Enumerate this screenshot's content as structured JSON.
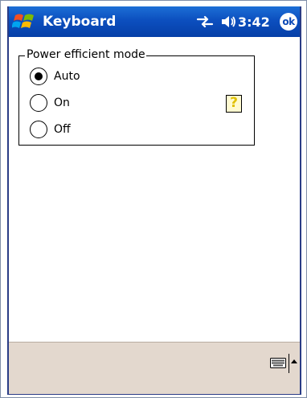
{
  "titlebar": {
    "title": "Keyboard",
    "clock": "3:42",
    "ok_label": "ok",
    "start_icon": "windows-flag-icon",
    "sync_icon": "connectivity-icon",
    "volume_icon": "speaker-icon"
  },
  "power_mode": {
    "group_label": "Power efficient mode",
    "options": [
      {
        "label": "Auto",
        "selected": true
      },
      {
        "label": "On",
        "selected": false
      },
      {
        "label": "Off",
        "selected": false
      }
    ],
    "help_label": "?"
  },
  "menubar": {
    "keyboard_icon": "keyboard-icon",
    "arrow_icon": "triangle-up-icon"
  },
  "colors": {
    "titlebar_blue": "#0c4fbf",
    "frame_blue": "#2a3c86",
    "menubar_bg": "#e3d8ce",
    "help_yellow": "#e0c000"
  }
}
